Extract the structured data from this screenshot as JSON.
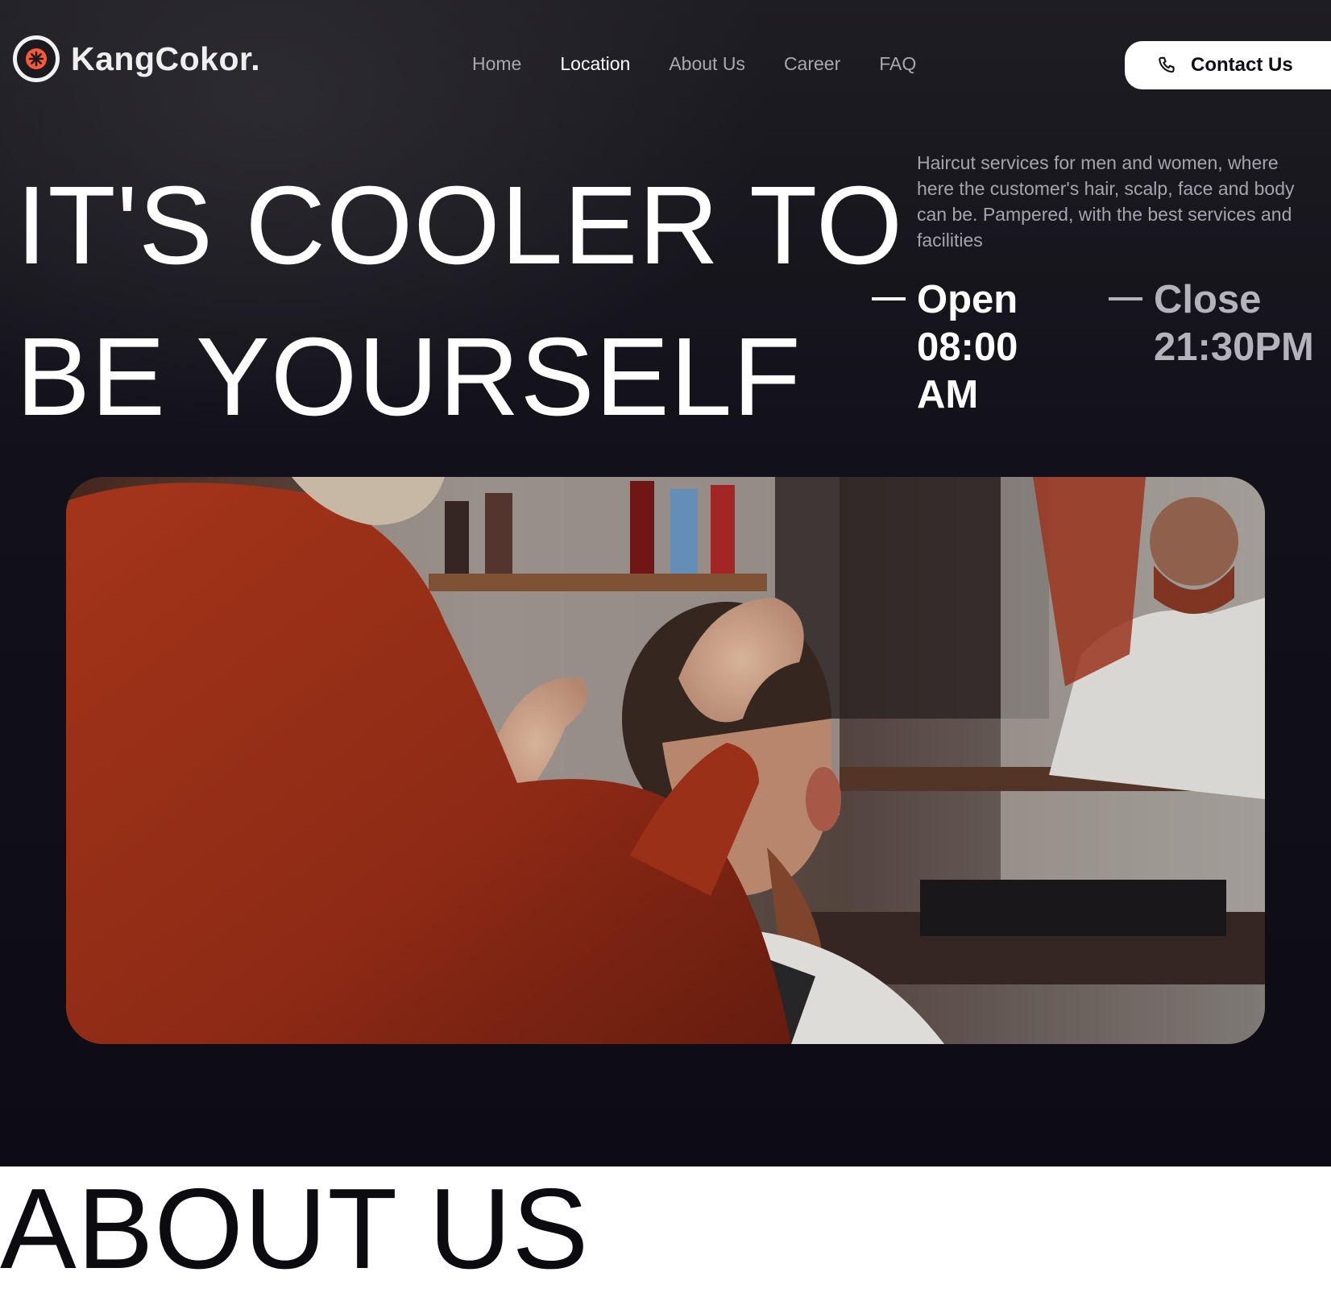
{
  "brand": {
    "name": "KangCokor."
  },
  "nav": {
    "items": [
      {
        "label": "Home",
        "active": false
      },
      {
        "label": "Location",
        "active": true
      },
      {
        "label": "About Us",
        "active": false
      },
      {
        "label": "Career",
        "active": false
      },
      {
        "label": "FAQ",
        "active": false
      }
    ]
  },
  "contact": {
    "label": "Contact Us",
    "icon": "phone-icon"
  },
  "hero": {
    "headline_line1": "IT'S COOLER TO",
    "headline_line2": "BE YOURSELF",
    "description": "Haircut services for men and women, where here the customer's hair, scalp, face and body can be. Pampered, with the best services and facilities",
    "open": {
      "label": "Open",
      "time": "08:00 AM"
    },
    "close": {
      "label": "Close",
      "time": "21:30PM"
    }
  },
  "about": {
    "title": "ABOUT US"
  },
  "colors": {
    "hero_background": "#121018",
    "logo_accent": "#ff5a36",
    "button_background": "#ffffff",
    "text_primary": "#ffffff",
    "text_muted": "#a4a4ab"
  }
}
